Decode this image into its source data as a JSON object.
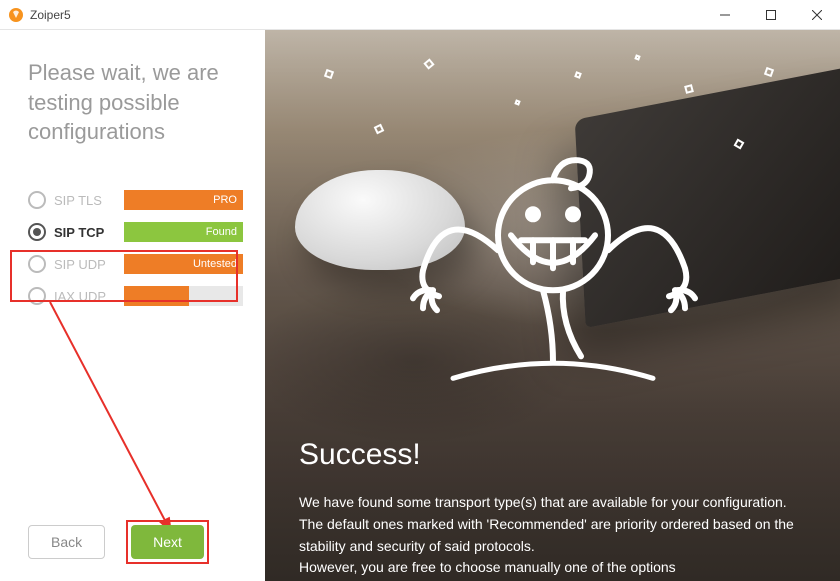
{
  "app": {
    "title": "Zoiper5"
  },
  "heading": "Please wait, we are testing possible configurations",
  "configs": [
    {
      "label": "SIP TLS",
      "status": "PRO",
      "selected": false,
      "bold": false,
      "fill_pct": 100,
      "fill_color": "#ee7d26",
      "badge_bg": "#ee7d26"
    },
    {
      "label": "SIP TCP",
      "status": "Found",
      "selected": true,
      "bold": true,
      "fill_pct": 100,
      "fill_color": "#8cc63f",
      "badge_bg": "#8cc63f"
    },
    {
      "label": "SIP UDP",
      "status": "Untested",
      "selected": false,
      "bold": false,
      "fill_pct": 100,
      "fill_color": "#ee7d26",
      "badge_bg": "#ee7d26"
    },
    {
      "label": "IAX UDP",
      "status": "",
      "selected": false,
      "bold": false,
      "fill_pct": 55,
      "fill_color": "#ee7d26",
      "badge_bg": ""
    }
  ],
  "buttons": {
    "back": "Back",
    "next": "Next"
  },
  "success": {
    "title": "Success!",
    "line1": "We have found some transport type(s) that are available for your configuration.",
    "line2": "The default ones marked with 'Recommended' are priority ordered based on the stability and security of said protocols.",
    "line3": "However, you are free to choose manually one of the options"
  },
  "colors": {
    "accent_green": "#8cc63f",
    "accent_orange": "#ee7d26",
    "callout_red": "#e7302a"
  }
}
